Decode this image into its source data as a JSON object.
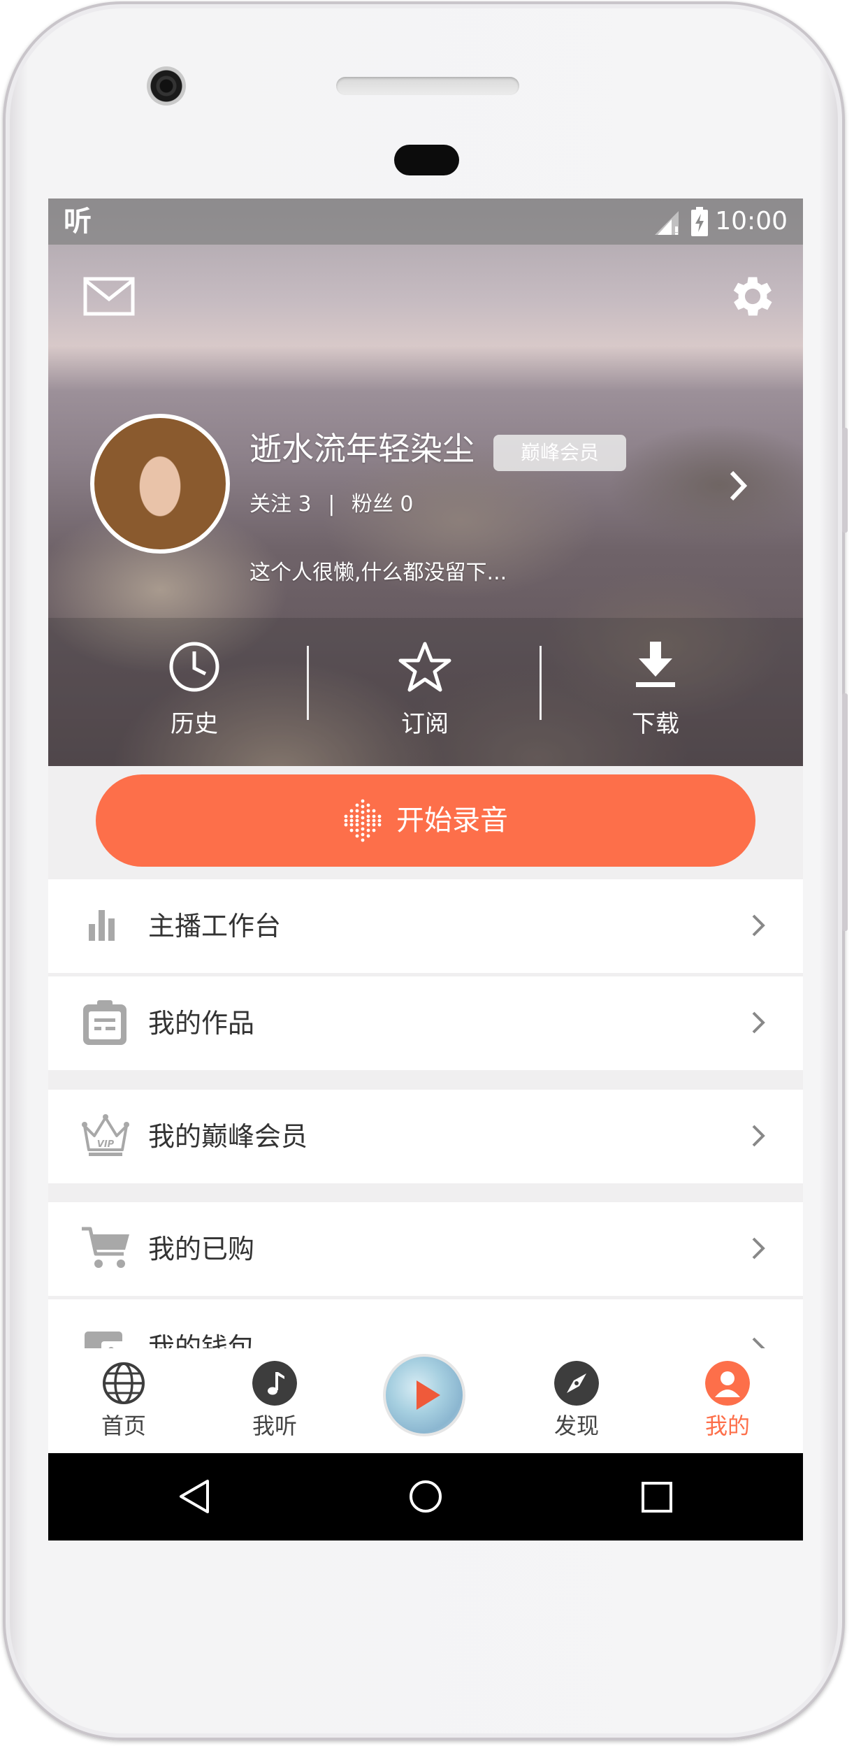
{
  "statusbar": {
    "app_glyph": "听",
    "time": "10:00"
  },
  "profile": {
    "username": "逝水流年轻染尘",
    "vip_badge": "巅峰会员",
    "follow_label": "关注",
    "follow_count": "3",
    "separator": "|",
    "fans_label": "粉丝",
    "fans_count": "0",
    "bio": "这个人很懒,什么都没留下..."
  },
  "quick_actions": [
    {
      "label": "历史",
      "icon": "clock-icon"
    },
    {
      "label": "订阅",
      "icon": "star-icon"
    },
    {
      "label": "下载",
      "icon": "download-icon"
    }
  ],
  "record_button": {
    "label": "开始录音",
    "icon": "waveform-dots-icon"
  },
  "menu": [
    {
      "label": "主播工作台",
      "icon": "bar-chart-icon"
    },
    {
      "label": "我的作品",
      "icon": "clipboard-icon"
    },
    {
      "label": "我的巅峰会员",
      "icon": "vip-crown-icon"
    },
    {
      "label": "我的已购",
      "icon": "cart-icon"
    },
    {
      "label": "我的钱包",
      "icon": "wallet-icon"
    }
  ],
  "bottom_nav": [
    {
      "label": "首页",
      "icon": "globe-icon"
    },
    {
      "label": "我听",
      "icon": "music-note-icon"
    },
    {
      "label": "",
      "icon": "play-disc-icon"
    },
    {
      "label": "发现",
      "icon": "compass-icon"
    },
    {
      "label": "我的",
      "icon": "user-icon",
      "active": true
    }
  ],
  "colors": {
    "accent": "#fd6f4a",
    "menu_text": "#333333",
    "icon_gray": "#a8a8a8",
    "nav_dark": "#3d3d3d"
  }
}
